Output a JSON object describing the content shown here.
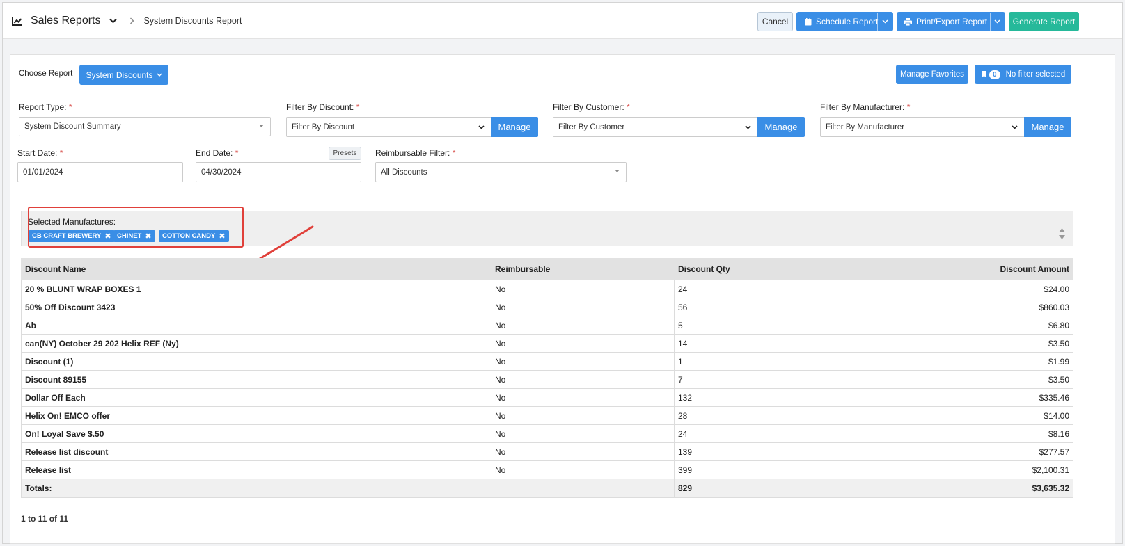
{
  "header": {
    "app_title": "Sales Reports",
    "breadcrumb": "System Discounts Report",
    "cancel_label": "Cancel",
    "schedule_label": "Schedule Report",
    "print_label": "Print/Export Report",
    "generate_label": "Generate Report"
  },
  "toolbar": {
    "choose_report_label": "Choose Report",
    "report_select_value": "System Discounts",
    "manage_favorites_label": "Manage Favorites",
    "filter_count": "0",
    "filter_status": "No filter selected"
  },
  "filters": {
    "report_type_label": "Report Type:",
    "report_type_value": "System Discount Summary",
    "discount_label": "Filter By Discount:",
    "discount_value": "Filter By Discount",
    "customer_label": "Filter By Customer:",
    "customer_value": "Filter By Customer",
    "manufacturer_label": "Filter By Manufacturer:",
    "manufacturer_value": "Filter By Manufacturer",
    "manage_label": "Manage",
    "start_date_label": "Start Date:",
    "start_date_value": "01/01/2024",
    "end_date_label": "End Date:",
    "end_date_value": "04/30/2024",
    "presets_label": "Presets",
    "reimbursable_label": "Reimbursable Filter:",
    "reimbursable_value": "All Discounts",
    "required_mark": "*"
  },
  "selected": {
    "label": "Selected Manufactures:",
    "chips": [
      "CB CRAFT BREWERY",
      "CHINET",
      "COTTON CANDY"
    ]
  },
  "table": {
    "columns": [
      "Discount Name",
      "Reimbursable",
      "Discount Qty",
      "Discount Amount"
    ],
    "rows": [
      [
        "20 % BLUNT WRAP BOXES 1",
        "No",
        "24",
        "$24.00"
      ],
      [
        "50% Off Discount 3423",
        "No",
        "56",
        "$860.03"
      ],
      [
        "Ab",
        "No",
        "5",
        "$6.80"
      ],
      [
        "can(NY) October 29 202 Helix REF (Ny)",
        "No",
        "14",
        "$3.50"
      ],
      [
        "Discount (1)",
        "No",
        "1",
        "$1.99"
      ],
      [
        "Discount 89155",
        "No",
        "7",
        "$3.50"
      ],
      [
        "Dollar Off Each",
        "No",
        "132",
        "$335.46"
      ],
      [
        "Helix On! EMCO offer",
        "No",
        "28",
        "$14.00"
      ],
      [
        "On! Loyal Save $.50",
        "No",
        "24",
        "$8.16"
      ],
      [
        "Release list discount",
        "No",
        "139",
        "$277.57"
      ],
      [
        "Release list",
        "No",
        "399",
        "$2,100.31"
      ]
    ],
    "totals": {
      "label": "Totals:",
      "reimbursable": "",
      "qty": "829",
      "amount": "$3,635.32"
    }
  },
  "pager": {
    "text": "1 to 11 of 11"
  },
  "icons": [
    "chart-line-icon",
    "chevron-down-icon",
    "chevron-right-icon",
    "calendar-icon",
    "printer-icon",
    "bookmark-icon",
    "close-icon",
    "scroll-arrows-icon",
    "annotation-arrow"
  ],
  "colors": {
    "primary": "#3a8ee6",
    "success": "#26b99a",
    "danger": "#e0403a"
  }
}
